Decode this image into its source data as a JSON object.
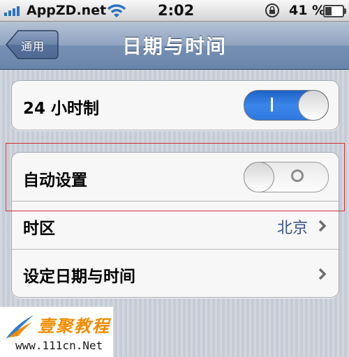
{
  "status_bar": {
    "carrier": "AppZD.net",
    "time": "2:02",
    "battery_percent": "41 %",
    "battery_level": 0.41,
    "icons": [
      "signal-icon",
      "wifi-icon",
      "rotation-lock-icon",
      "battery-icon"
    ]
  },
  "nav": {
    "back_label": "通用",
    "title": "日期与时间"
  },
  "settings": {
    "hour24": {
      "label": "24 小时制",
      "on": true
    },
    "auto_set": {
      "label": "自动设置",
      "on": false
    },
    "timezone": {
      "label": "时区",
      "value": "北京"
    },
    "set_datetime": {
      "label": "设定日期与时间"
    }
  },
  "watermark": {
    "title": "壹聚教程",
    "url": "www.111cn.Net"
  },
  "colors": {
    "toggle_on": "#2e78e0",
    "value_text": "#385487",
    "highlight_border": "#d23030",
    "watermark_title": "#f28c00"
  }
}
